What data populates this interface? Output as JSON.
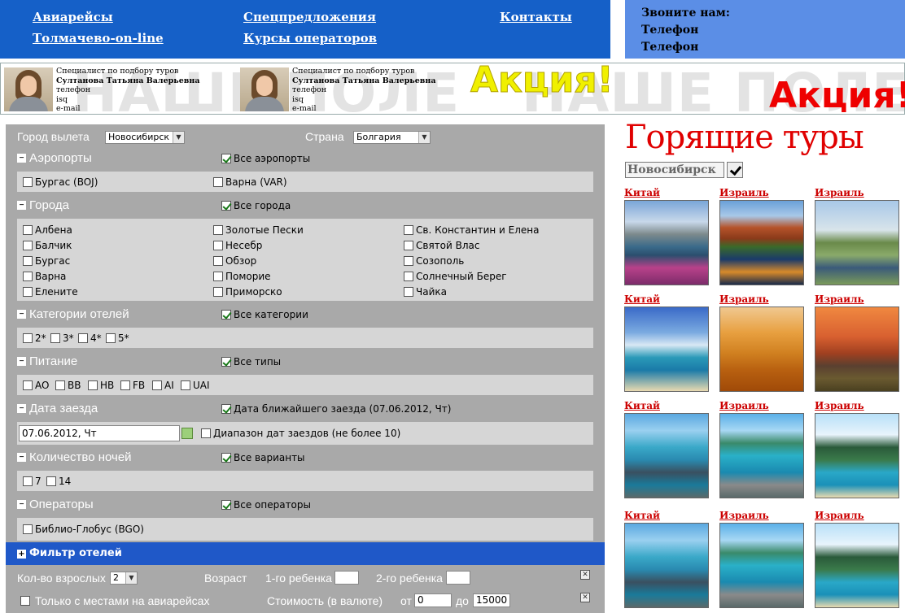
{
  "nav": {
    "links": [
      "Авиарейсы",
      "Толмачево-on-line",
      "Спецпредложения",
      "Курсы операторов",
      "Контакты"
    ]
  },
  "callbox": {
    "title": "Звоните нам:",
    "phone1": "Телефон",
    "phone2": "Телефон"
  },
  "banner": {
    "watermark": "НАШЕ ПОЛЕ",
    "specialists": [
      {
        "role": "Специалист по подбору туров",
        "name": "Султанова Татьяна Валерьевна",
        "phone": "телефон",
        "isq": "isq",
        "email": "e-mail"
      },
      {
        "role": "Специалист по подбору туров",
        "name": "Султанова Татьяна Валерьевна",
        "phone": "телефон",
        "isq": "isq",
        "email": "e-mail"
      }
    ],
    "promo1": "Акция!",
    "promo2": "Акция!",
    "colors": {
      "promo1": "#f0f000",
      "promo2": "#ee0000"
    }
  },
  "form": {
    "departure_label": "Город вылета",
    "departure_value": "Новосибирск",
    "country_label": "Страна",
    "country_value": "Болгария",
    "airports": {
      "title": "Аэропорты",
      "all": "Все аэропорты",
      "items": [
        "Бургас (BOJ)",
        "Варна (VAR)"
      ]
    },
    "cities": {
      "title": "Города",
      "all": "Все города",
      "col1": [
        "Албена",
        "Балчик",
        "Бургас",
        "Варна",
        "Елените"
      ],
      "col2": [
        "Золотые Пески",
        "Несебр",
        "Обзор",
        "Поморие",
        "Приморско"
      ],
      "col3": [
        "Св. Константин и Елена",
        "Святой Влас",
        "Созополь",
        "Солнечный Берег",
        "Чайка"
      ]
    },
    "categories": {
      "title": "Категории отелей",
      "all": "Все категории",
      "items": [
        "2*",
        "3*",
        "4*",
        "5*"
      ]
    },
    "meals": {
      "title": "Питание",
      "all": "Все типы",
      "items": [
        "AO",
        "BB",
        "HB",
        "FB",
        "AI",
        "UAI"
      ]
    },
    "date": {
      "title": "Дата заезда",
      "nearest": "Дата ближайшего заезда (07.06.2012, Чт)",
      "value": "07.06.2012, Чт",
      "range": "Диапазон дат заездов (не более 10)"
    },
    "nights": {
      "title": "Количество ночей",
      "all": "Все варианты",
      "items": [
        "7",
        "14"
      ]
    },
    "operators": {
      "title": "Операторы",
      "all": "Все операторы",
      "items": [
        "Библио-Глобус (BGO)"
      ]
    },
    "filter_hotels": "Фильтр отелей",
    "adults_label": "Кол-во взрослых",
    "adults_value": "2",
    "age_label": "Возраст",
    "child1_label": "1-го ребенка",
    "child2_label": "2-го ребенка",
    "only_seats": "Только с местами на авиарейсах",
    "price_label": "Стоимость (в валюте)",
    "from_label": "от",
    "from_value": "0",
    "to_label": "до",
    "to_value": "15000"
  },
  "hot": {
    "title": "Горящие туры",
    "city": "Новосибирск",
    "tours": [
      {
        "label": "Китай",
        "image": "mountain-lake-flowers"
      },
      {
        "label": "Израиль",
        "image": "red-rock-lake"
      },
      {
        "label": "Израиль",
        "image": "golf-course"
      },
      {
        "label": "Китай",
        "image": "tropical-beach-palms"
      },
      {
        "label": "Израиль",
        "image": "desert-dunes"
      },
      {
        "label": "Израиль",
        "image": "stonehenge-sunset"
      },
      {
        "label": "Китай",
        "image": "rocky-lagoon"
      },
      {
        "label": "Израиль",
        "image": "yacht-bay"
      },
      {
        "label": "Израиль",
        "image": "tropical-cliffs-boat"
      },
      {
        "label": "Китай",
        "image": "rocky-lagoon"
      },
      {
        "label": "Израиль",
        "image": "yacht-bay"
      },
      {
        "label": "Израиль",
        "image": "tropical-cliffs-boat"
      }
    ]
  }
}
